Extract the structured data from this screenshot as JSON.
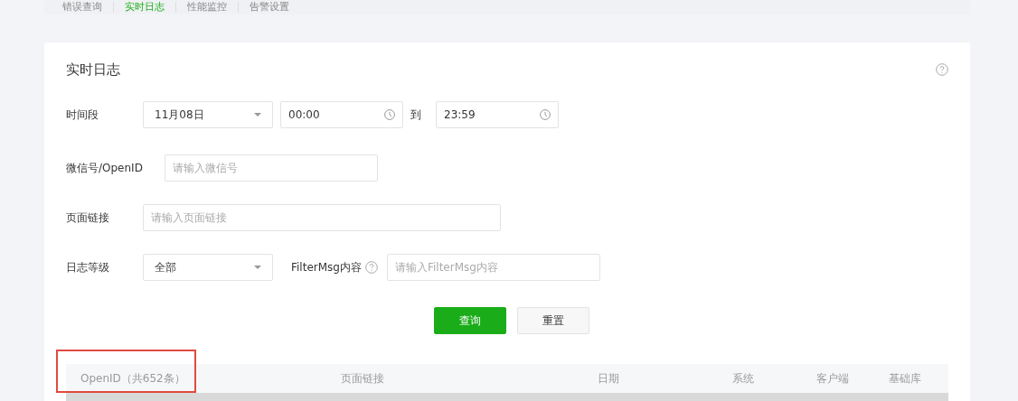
{
  "tabs": [
    {
      "label": "错误查询",
      "selected": false
    },
    {
      "label": "实时日志",
      "selected": true
    },
    {
      "label": "性能监控",
      "selected": false
    },
    {
      "label": "告警设置",
      "selected": false
    }
  ],
  "card": {
    "title": "实时日志"
  },
  "form": {
    "time_range": {
      "label": "时间段",
      "date": "11月08日",
      "start": "00:00",
      "separator": "到",
      "end": "23:59"
    },
    "wechat": {
      "label": "微信号/OpenID",
      "placeholder": "请输入微信号"
    },
    "page_link": {
      "label": "页面链接",
      "placeholder": "请输入页面链接"
    },
    "log_level": {
      "label": "日志等级",
      "value": "全部"
    },
    "filter_msg": {
      "label": "FilterMsg内容",
      "placeholder": "请输入FilterMsg内容"
    }
  },
  "buttons": [
    {
      "label": "查询",
      "kind": "primary"
    },
    {
      "label": "重置",
      "kind": "default"
    }
  ],
  "table": {
    "highlight_frame": true,
    "columns": [
      {
        "label": "OpenID（共652条）"
      },
      {
        "label": "页面链接"
      },
      {
        "label": "日期"
      },
      {
        "label": "系统"
      },
      {
        "label": "客户端"
      },
      {
        "label": "基础库"
      }
    ]
  }
}
